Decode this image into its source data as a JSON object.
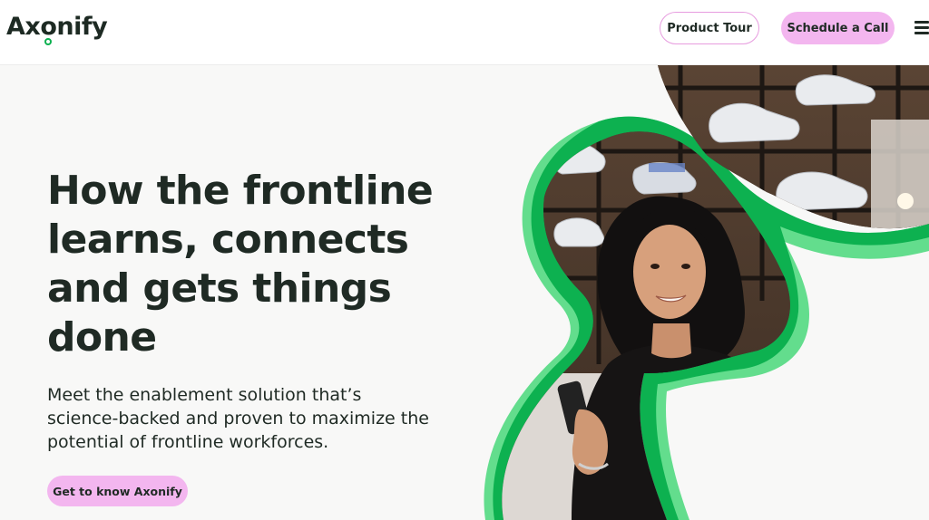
{
  "header": {
    "logo": {
      "part1": "Ax",
      "part2": "o",
      "part3": "nify"
    },
    "product_tour_label": "Product Tour",
    "schedule_call_label": "Schedule a Call",
    "menu_icon": "hamburger-menu-icon"
  },
  "hero": {
    "title": "How the frontline learns, connects and gets things done",
    "subtitle": "Meet the enablement solution that’s science-backed and proven to maximize the potential of frontline workforces.",
    "cta_label": "Get to know Axonify"
  },
  "colors": {
    "brand_green": "#0db150",
    "light_green": "#63dd8d",
    "pink_button": "#f3b6ef",
    "pink_border": "#e79cdf",
    "text_dark": "#1f2a24",
    "background": "#f8f8f7"
  }
}
